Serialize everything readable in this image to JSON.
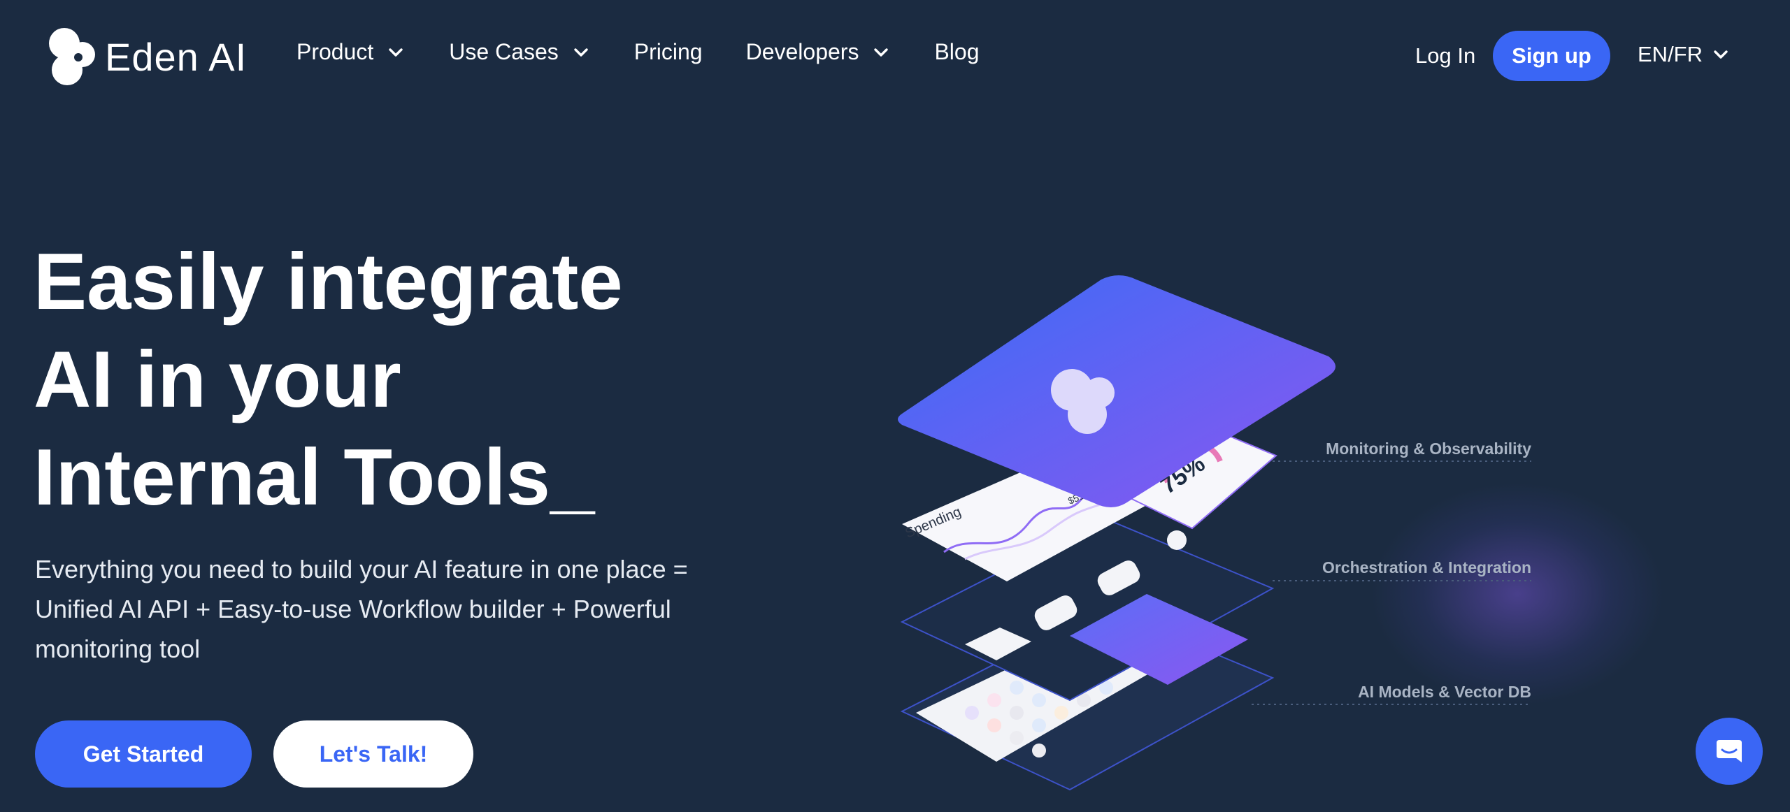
{
  "brand": {
    "name": "Eden AI",
    "accent": "#3a66f5",
    "background": "#1b2b41"
  },
  "nav": {
    "items": [
      {
        "label": "Product",
        "dropdown": true
      },
      {
        "label": "Use Cases",
        "dropdown": true
      },
      {
        "label": "Pricing",
        "dropdown": false
      },
      {
        "label": "Developers",
        "dropdown": true
      },
      {
        "label": "Blog",
        "dropdown": false
      }
    ],
    "login": "Log In",
    "signup": "Sign up",
    "language": "EN/FR"
  },
  "hero": {
    "title_lines": [
      "Easily integrate",
      "AI in your",
      "Internal Tools_"
    ],
    "subtitle": "Everything you need to build your AI feature in one place = Unified AI API + Easy-to-use Workflow builder + Powerful monitoring tool",
    "cta_primary": "Get Started",
    "cta_secondary": "Let's Talk!"
  },
  "illustration": {
    "labels": [
      "Monitoring & Observability",
      "Orchestration & Integration",
      "AI Models & Vector DB"
    ],
    "card_spending": "Spending",
    "card_amount": "$510",
    "card_percent": "75%"
  },
  "icons": [
    "eden-logo-icon",
    "chevron-down-icon",
    "chat-icon"
  ]
}
